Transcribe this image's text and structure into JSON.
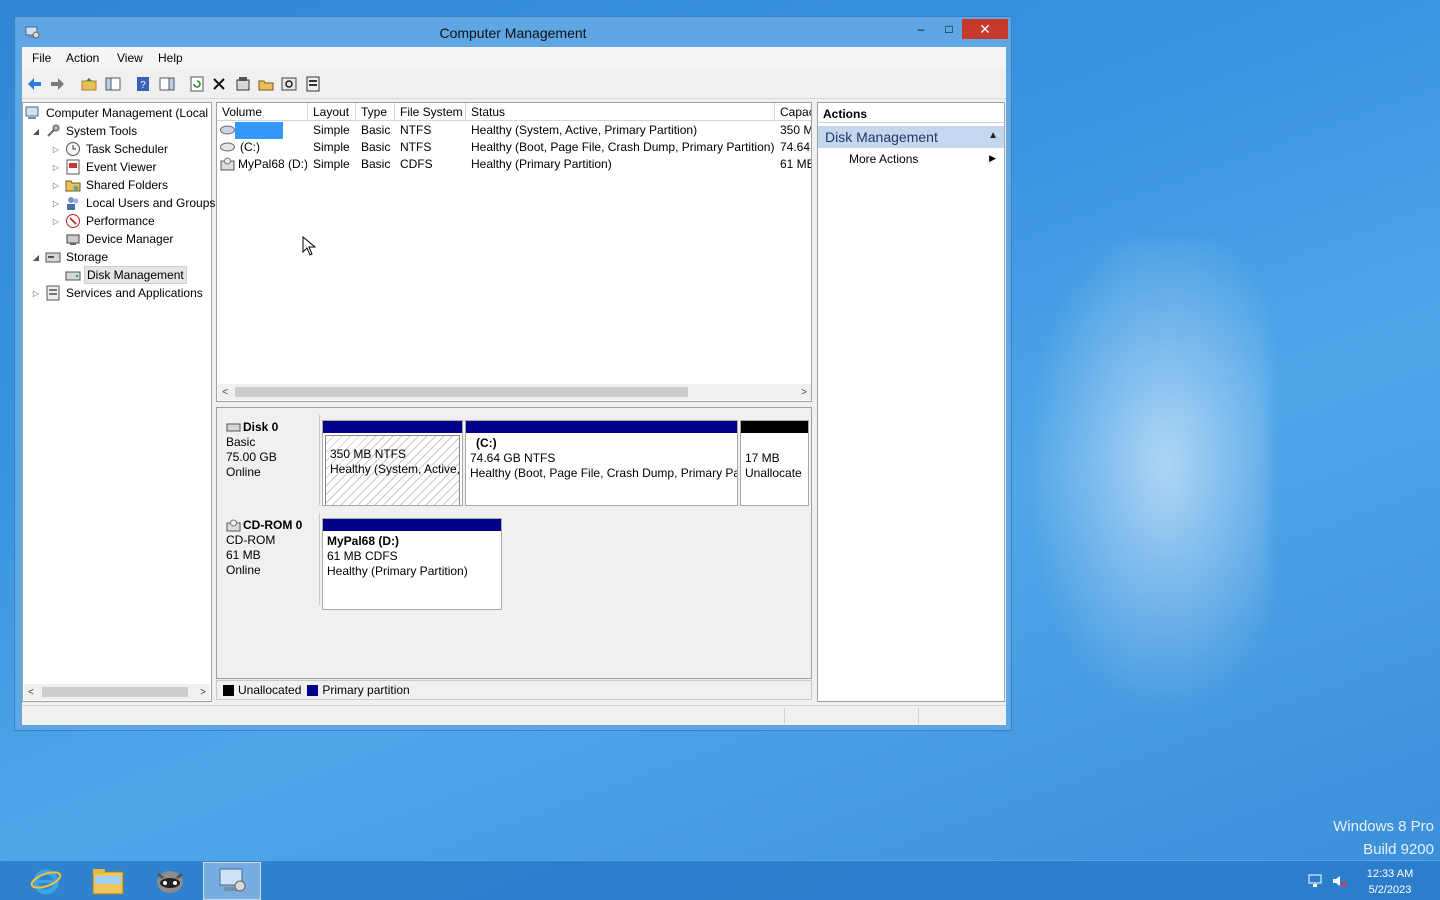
{
  "window": {
    "title": "Computer Management",
    "minimize_glyph": "–",
    "maximize_glyph": "□",
    "close_glyph": "✕"
  },
  "menu": {
    "items": [
      "File",
      "Action",
      "View",
      "Help"
    ]
  },
  "toolbar": {
    "icons": [
      "back-arrow-icon",
      "forward-arrow-icon",
      "up-folder-icon",
      "show-hide-tree-icon",
      "help-icon",
      "show-hide-action-pane-icon",
      "refresh-icon",
      "delete-icon",
      "properties-icon",
      "open-folder-icon",
      "search-icon",
      "settings-icon"
    ]
  },
  "tree": {
    "root": "Computer Management (Local",
    "system_tools": "System Tools",
    "task_scheduler": "Task Scheduler",
    "event_viewer": "Event Viewer",
    "shared_folders": "Shared Folders",
    "local_users": "Local Users and Groups",
    "performance": "Performance",
    "device_manager": "Device Manager",
    "storage": "Storage",
    "disk_management": "Disk Management",
    "services_apps": "Services and Applications",
    "collapse_glyph": "◢",
    "expand_glyph": "▷"
  },
  "volumes": {
    "columns": [
      "Volume",
      "Layout",
      "Type",
      "File System",
      "Status",
      "Capac"
    ],
    "rows": [
      {
        "volume": "",
        "layout": "Simple",
        "type": "Basic",
        "fs": "NTFS",
        "status": "Healthy (System, Active, Primary Partition)",
        "capacity": "350 M"
      },
      {
        "volume": "(C:)",
        "layout": "Simple",
        "type": "Basic",
        "fs": "NTFS",
        "status": "Healthy (Boot, Page File, Crash Dump, Primary Partition)",
        "capacity": "74.64"
      },
      {
        "volume": "MyPal68 (D:)",
        "layout": "Simple",
        "type": "Basic",
        "fs": "CDFS",
        "status": "Healthy (Primary Partition)",
        "capacity": "61 ME"
      }
    ]
  },
  "disks": {
    "disk0": {
      "name": "Disk 0",
      "type": "Basic",
      "size": "75.00 GB",
      "state": "Online",
      "partitions": [
        {
          "line1": "",
          "line2": "350 MB NTFS",
          "line3": "Healthy (System, Active,"
        },
        {
          "line1": "(C:)",
          "line2": "74.64 GB NTFS",
          "line3": "Healthy (Boot, Page File, Crash Dump, Primary Pa"
        },
        {
          "line1": "17 MB",
          "line2": "Unallocate"
        }
      ]
    },
    "cdrom0": {
      "name": "CD-ROM 0",
      "type": "CD-ROM",
      "size": "61 MB",
      "state": "Online",
      "partition": {
        "line1": "MyPal68  (D:)",
        "line2": "61 MB CDFS",
        "line3": "Healthy (Primary Partition)"
      }
    }
  },
  "legend": {
    "unallocated": "Unallocated",
    "primary": "Primary partition",
    "unallocated_color": "#000000",
    "primary_color": "#00008b"
  },
  "actions": {
    "header": "Actions",
    "section": "Disk Management",
    "more_actions": "More Actions",
    "section_caret": "▲",
    "item_caret": "▶"
  },
  "scroll": {
    "left_glyph": "<",
    "right_glyph": ">"
  },
  "desktop": {
    "edition": "Windows 8 Pro",
    "build": "Build 9200"
  },
  "taskbar": {
    "time": "12:33 AM",
    "date": "5/2/2023"
  },
  "colors": {
    "selection_blue": "#3399ff",
    "primary_bar": "#00008b",
    "close_red": "#c7392b"
  }
}
